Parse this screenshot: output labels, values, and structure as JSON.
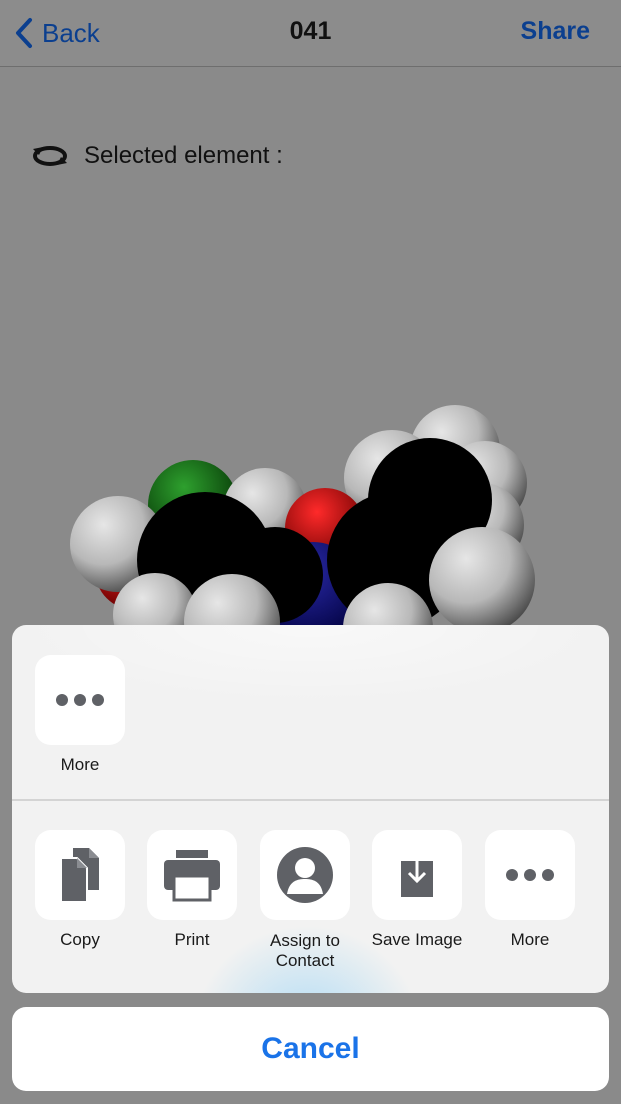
{
  "nav": {
    "back_label": "Back",
    "title": "041",
    "share_label": "Share"
  },
  "viewer": {
    "selected_label": "Selected element :"
  },
  "share_sheet": {
    "top_row": [
      {
        "label": "More",
        "icon": "more-dots-icon"
      }
    ],
    "actions": [
      {
        "label": "Copy",
        "icon": "copy-icon"
      },
      {
        "label": "Print",
        "icon": "printer-icon"
      },
      {
        "label": "Assign to\nContact",
        "icon": "contact-icon"
      },
      {
        "label": "Save Image",
        "icon": "save-image-icon"
      },
      {
        "label": "More",
        "icon": "more-dots-icon"
      }
    ],
    "cancel_label": "Cancel"
  },
  "colors": {
    "link_blue": "#0b3f8f",
    "cancel_blue": "#1a73e8",
    "background_gray": "#8a8a8a",
    "icon_gray": "#5f6166"
  }
}
